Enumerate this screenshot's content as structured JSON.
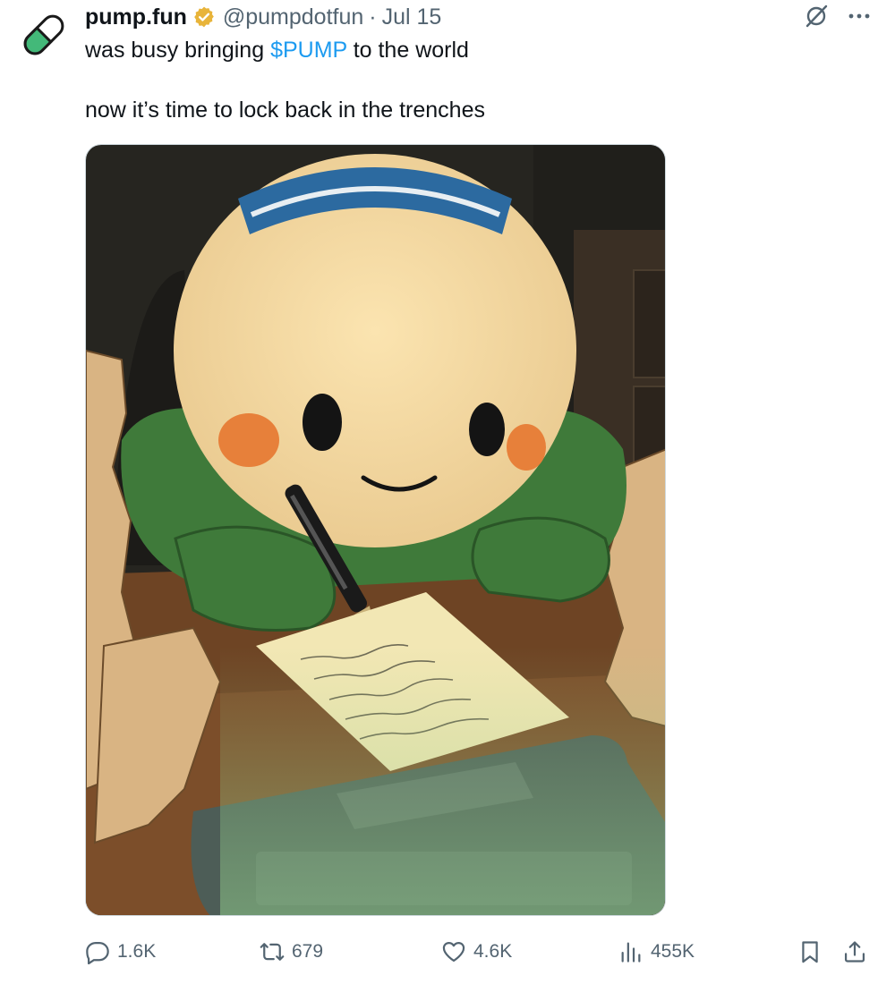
{
  "author": {
    "display_name": "pump.fun",
    "handle": "@pumpdotfun",
    "separator": "·",
    "date": "Jul 15",
    "verified_badge": "gold-verified-badge-icon",
    "avatar": "green-pill-avatar"
  },
  "tweet": {
    "line1_prefix": "was busy bringing ",
    "cashtag": "$PUMP",
    "line1_suffix": " to the world",
    "line2": "now it’s time to lock back in the trenches"
  },
  "media": {
    "description_icon": "cartoon-pill-character-writing-at-desk"
  },
  "actions": {
    "replies": "1.6K",
    "reposts": "679",
    "likes": "4.6K",
    "views": "455K"
  },
  "colors": {
    "link": "#1d9bf0",
    "secondary": "#536471",
    "verified": "#e8b43a",
    "avatar_green": "#43b979"
  }
}
